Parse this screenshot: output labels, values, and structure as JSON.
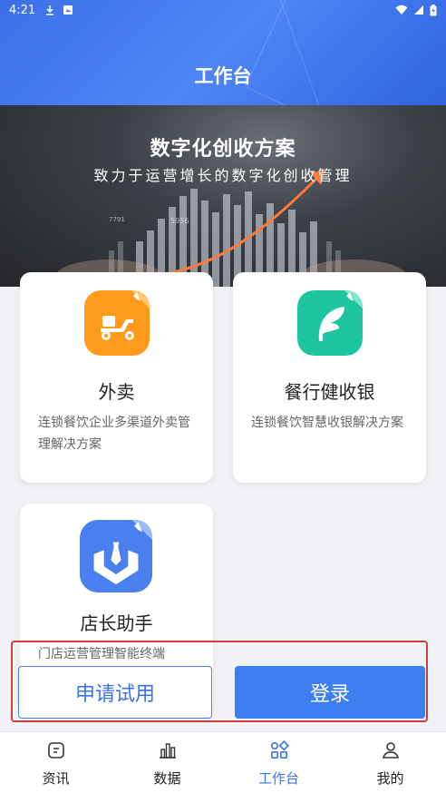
{
  "status_bar": {
    "time": "4:21"
  },
  "header": {
    "title": "工作台"
  },
  "banner": {
    "title": "数字化创收方案",
    "subtitle": "致力于运营增长的数字化创收管理"
  },
  "cards": [
    {
      "name": "外卖",
      "desc": "连锁餐饮企业多渠道外卖管理解决方案",
      "icon": "delivery-scooter-icon",
      "color": "#ff9a1a"
    },
    {
      "name": "餐行健收银",
      "desc": "连锁餐饮智慧收银解决方案",
      "icon": "cashier-leaf-icon",
      "color": "#1ec6a0"
    },
    {
      "name": "店长助手",
      "desc": "门店运营管理智能终端",
      "icon": "manager-tie-icon",
      "color": "#4a7ff0"
    }
  ],
  "actions": {
    "trial_label": "申请试用",
    "login_label": "登录"
  },
  "tabs": [
    {
      "label": "资讯",
      "icon": "news-icon"
    },
    {
      "label": "数据",
      "icon": "data-chart-icon"
    },
    {
      "label": "工作台",
      "icon": "workbench-icon",
      "active": true
    },
    {
      "label": "我的",
      "icon": "profile-icon"
    }
  ],
  "colors": {
    "primary": "#3d7ef2",
    "highlight": "#d33b3b"
  }
}
